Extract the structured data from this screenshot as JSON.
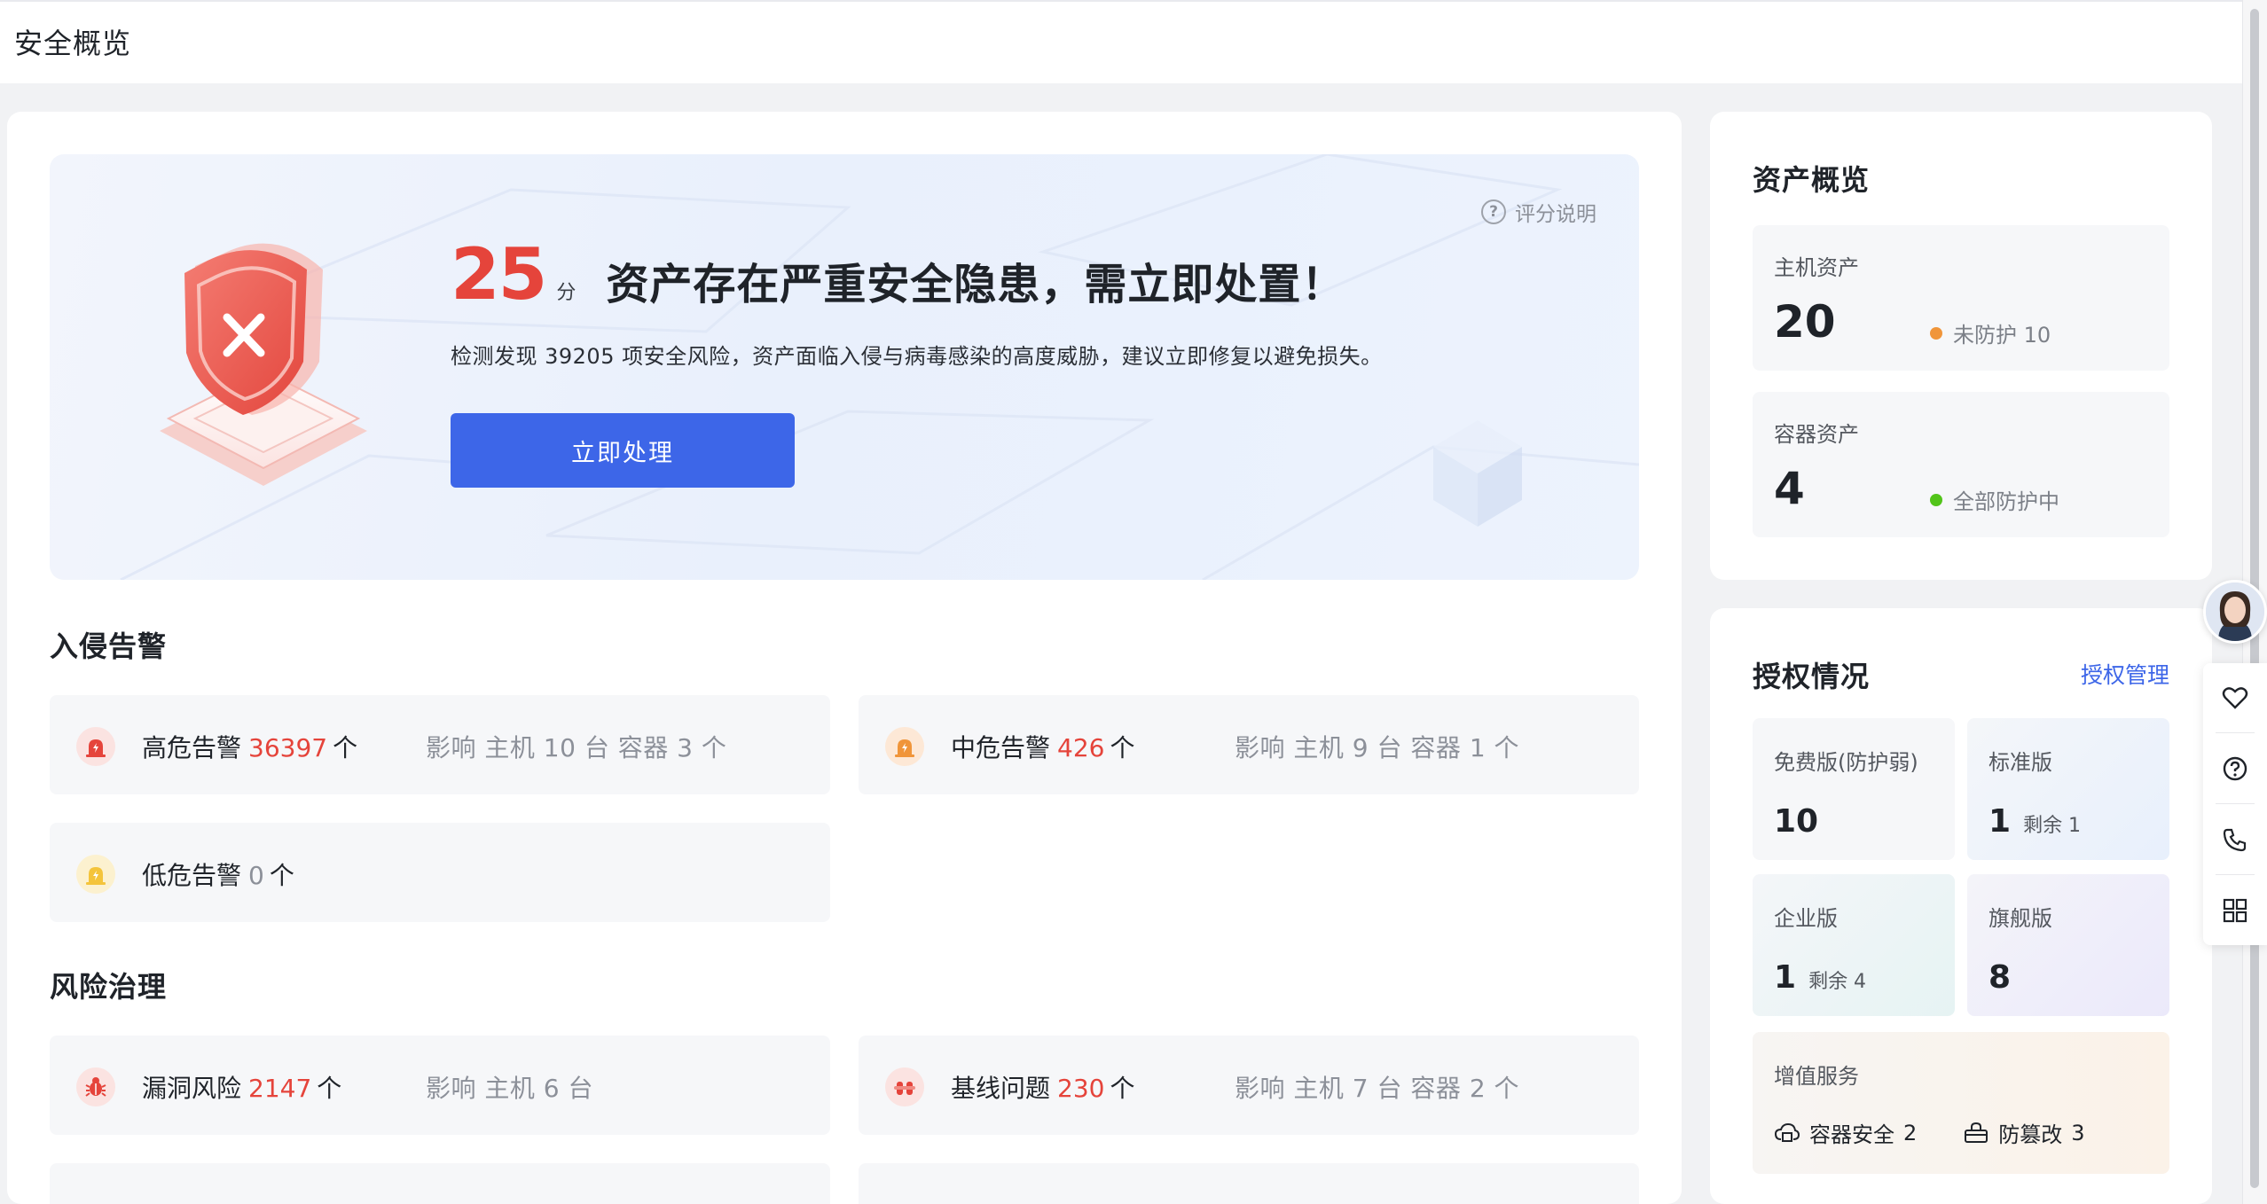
{
  "header": {
    "title": "安全概览"
  },
  "score": {
    "value": "25",
    "unit": "分",
    "headline": "资产存在严重安全隐患，需立即处置！",
    "description": "检测发现 39205 项安全风险，资产面临入侵与病毒感染的高度威胁，建议立即修复以避免损失。",
    "action_label": "立即处理",
    "help_label": "评分说明"
  },
  "intrusion": {
    "title": "入侵告警",
    "items": [
      {
        "name": "高危告警",
        "count": "36397",
        "unit": "个",
        "impact": "影响 主机 10 台 容器 3 个"
      },
      {
        "name": "中危告警",
        "count": "426",
        "unit": "个",
        "impact": "影响 主机 9 台 容器 1 个"
      },
      {
        "name": "低危告警",
        "count": "0",
        "unit": "个",
        "impact": ""
      }
    ]
  },
  "risk": {
    "title": "风险治理",
    "items": [
      {
        "name": "漏洞风险",
        "count": "2147",
        "unit": "个",
        "impact": "影响 主机 6 台"
      },
      {
        "name": "基线问题",
        "count": "230",
        "unit": "个",
        "impact": "影响 主机 7 台 容器 2 个"
      }
    ]
  },
  "assets": {
    "title": "资产概览",
    "host": {
      "label": "主机资产",
      "count": "20",
      "status": "未防护 10",
      "status_color": "#f0953a"
    },
    "container": {
      "label": "容器资产",
      "count": "4",
      "status": "全部防护中",
      "status_color": "#52c41a"
    }
  },
  "license": {
    "title": "授权情况",
    "manage_label": "授权管理",
    "tiers": [
      {
        "label": "免费版(防护弱)",
        "count": "10",
        "extra": ""
      },
      {
        "label": "标准版",
        "count": "1",
        "extra": "剩余 1"
      },
      {
        "label": "企业版",
        "count": "1",
        "extra": "剩余 4"
      },
      {
        "label": "旗舰版",
        "count": "8",
        "extra": ""
      }
    ],
    "value_added": {
      "label": "增值服务",
      "items": [
        {
          "name": "容器安全",
          "count": "2"
        },
        {
          "name": "防篡改",
          "count": "3"
        }
      ]
    }
  },
  "colors": {
    "primary": "#3d66e8",
    "danger": "#e5443b",
    "warning": "#f0953a",
    "success": "#52c41a"
  },
  "icons": {
    "toolbar": [
      "heart-icon",
      "help-icon",
      "phone-icon",
      "grid-icon"
    ]
  }
}
